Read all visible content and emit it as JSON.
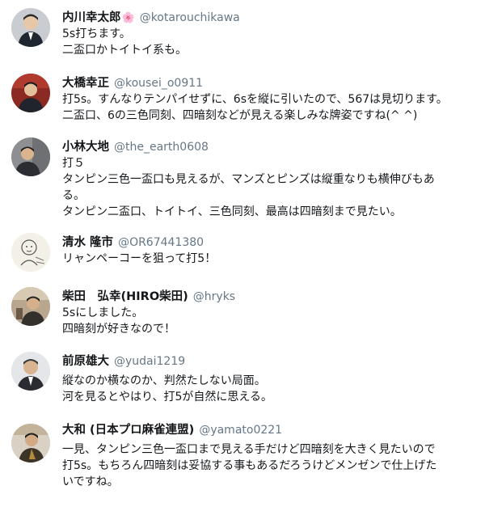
{
  "tweets": [
    {
      "name": "内川幸太郎",
      "name_emoji": "🌸",
      "handle": "@kotarouchikawa",
      "lines": [
        "5s打ちます。",
        "二盃口かトイトイ系も。"
      ]
    },
    {
      "name": "大橋幸正",
      "handle": "@kousei_o0911",
      "lines": [
        "打5s。すんなりテンパイせずに、6sを縦に引いたので、567は見切ります。",
        "二盃口、6の三色同刻、四暗刻などが見える楽しみな牌姿ですね(^ ^)"
      ]
    },
    {
      "name": "小林大地",
      "handle": "@the_earth0608",
      "lines": [
        "打５",
        "タンピン三色一盃口も見えるが、マンズとピンズは縦重なりも横伸びもあ",
        "る。",
        "タンピン二盃口、トイトイ、三色同刻、最高は四暗刻まで見たい。"
      ]
    },
    {
      "name": "清水 隆市",
      "handle": "@OR67441380",
      "lines": [
        "リャンペーコーを狙って打5！"
      ]
    },
    {
      "name": "柴田　弘幸(HIRO柴田)",
      "handle": "@hryks",
      "lines": [
        "5sにしました。",
        "四暗刻が好きなので！"
      ]
    },
    {
      "name": "前原雄大",
      "handle": "@yudai1219",
      "lines": [
        "縦なのか横なのか、判然たしない局面。",
        "河を見るとやはり、打5が自然に思える。"
      ]
    },
    {
      "name": "大和 (日本プロ麻雀連盟)",
      "handle": "@yamato0221",
      "lines": [
        "一見、タンピン三色一盃口まで見える手だけど四暗刻を大きく見たいので",
        "打5s。もちろん四暗刻は妥協する事もあるだろうけどメンゼンで仕上げた",
        "いですね。"
      ]
    }
  ]
}
